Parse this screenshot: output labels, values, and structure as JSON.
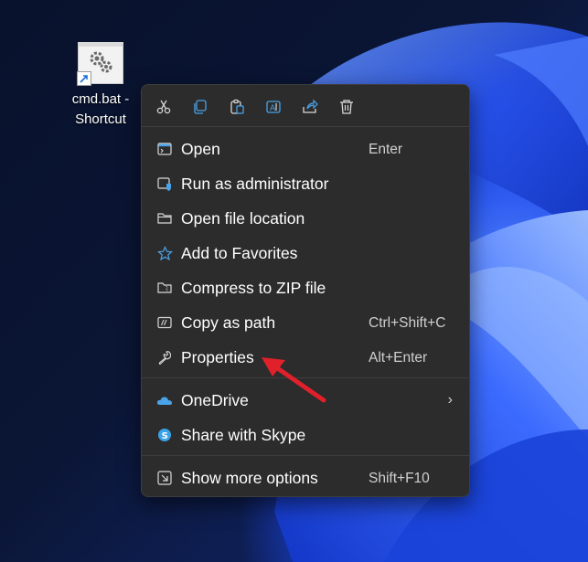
{
  "desktop": {
    "icon_label": "cmd.bat -\nShortcut"
  },
  "toolbar": {
    "buttons": [
      {
        "icon": "cut-icon"
      },
      {
        "icon": "copy-icon"
      },
      {
        "icon": "paste-icon"
      },
      {
        "icon": "rename-icon"
      },
      {
        "icon": "share-icon"
      },
      {
        "icon": "delete-icon"
      }
    ]
  },
  "menu": {
    "items": [
      {
        "label": "Open",
        "shortcut": "Enter",
        "icon": "open-window-icon"
      },
      {
        "label": "Run as administrator",
        "shortcut": "",
        "icon": "shield-admin-icon"
      },
      {
        "label": "Open file location",
        "shortcut": "",
        "icon": "folder-icon"
      },
      {
        "label": "Add to Favorites",
        "shortcut": "",
        "icon": "star-icon"
      },
      {
        "label": "Compress to ZIP file",
        "shortcut": "",
        "icon": "zip-folder-icon"
      },
      {
        "label": "Copy as path",
        "shortcut": "Ctrl+Shift+C",
        "icon": "copy-path-icon"
      },
      {
        "label": "Properties",
        "shortcut": "Alt+Enter",
        "icon": "wrench-icon"
      },
      {
        "label": "OneDrive",
        "shortcut": "",
        "icon": "onedrive-icon",
        "submenu": "›"
      },
      {
        "label": "Share with Skype",
        "shortcut": "",
        "icon": "skype-icon"
      },
      {
        "label": "Show more options",
        "shortcut": "Shift+F10",
        "icon": "more-options-icon"
      }
    ]
  },
  "colors": {
    "menu_bg": "#2c2c2c",
    "accent_blue": "#4aa3e8",
    "arrow_red": "#e0202a"
  }
}
